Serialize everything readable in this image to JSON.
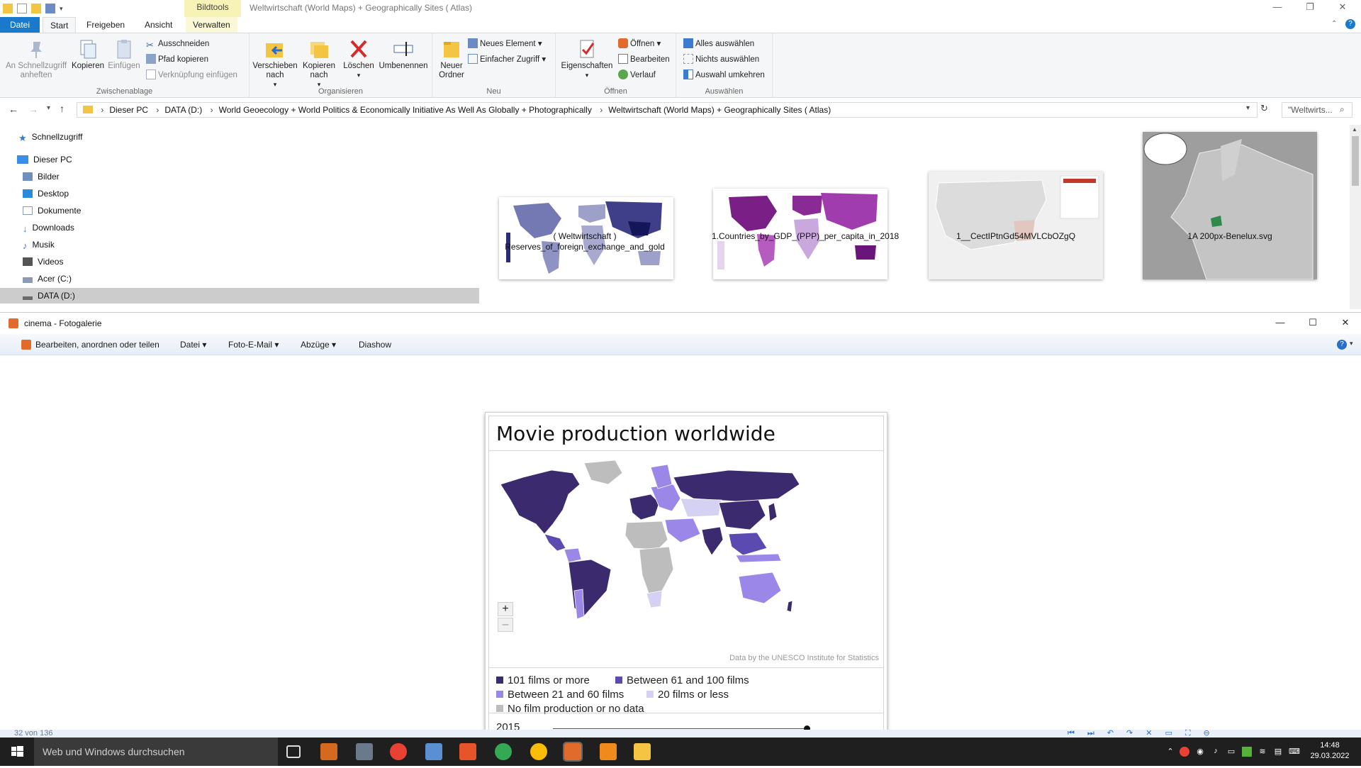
{
  "explorer": {
    "window_title": "Weltwirtschaft (World Maps) + Geographically Sites ( Atlas)",
    "context_tab": "Bildtools",
    "tabs": [
      "Datei",
      "Start",
      "Freigeben",
      "Ansicht",
      "Verwalten"
    ],
    "ribbon": {
      "clipboard": {
        "label": "Zwischenablage",
        "pin": "An Schnellzugriff anheften",
        "copy": "Kopieren",
        "paste": "Einfügen",
        "cut": "Ausschneiden",
        "copy_path": "Pfad kopieren",
        "paste_shortcut": "Verknüpfung einfügen"
      },
      "organize": {
        "label": "Organisieren",
        "move_to": "Verschieben nach",
        "copy_to": "Kopieren nach",
        "delete": "Löschen",
        "rename": "Umbenennen"
      },
      "new": {
        "label": "Neu",
        "new_folder": "Neuer Ordner",
        "new_item": "Neues Element",
        "easy_access": "Einfacher Zugriff"
      },
      "open": {
        "label": "Öffnen",
        "properties": "Eigenschaften",
        "open": "Öffnen",
        "edit": "Bearbeiten",
        "history": "Verlauf"
      },
      "select": {
        "label": "Auswählen",
        "select_all": "Alles auswählen",
        "select_none": "Nichts auswählen",
        "invert": "Auswahl umkehren"
      }
    },
    "address": [
      "Dieser PC",
      "DATA (D:)",
      "World Geoecology + World Politics & Economically Initiative As Well As Globally + Photographically",
      "Weltwirtschaft (World Maps) + Geographically Sites ( Atlas)"
    ],
    "search_placeholder": "\"Weltwirts...",
    "nav": {
      "quick_access": "Schnellzugriff",
      "this_pc": "Dieser PC",
      "items": [
        "Bilder",
        "Desktop",
        "Dokumente",
        "Downloads",
        "Musik",
        "Videos",
        "Acer (C:)",
        "DATA (D:)"
      ]
    },
    "files": [
      {
        "name_line1": "( Weltwirtschaft )",
        "name_line2": "Reserves_of_foreign_exchange_and_gold"
      },
      {
        "name_line1": "1.Countries_by_GDP_(PPP)_per_capita_in_2018",
        "name_line2": ""
      },
      {
        "name_line1": "1__CectIPtnGd54MVLCbOZgQ",
        "name_line2": ""
      },
      {
        "name_line1": "1A 200px-Benelux.svg",
        "name_line2": ""
      }
    ]
  },
  "gallery": {
    "window_title": "cinema - Fotogalerie",
    "menu": {
      "edit": "Bearbeiten, anordnen oder teilen",
      "file": "Datei",
      "email": "Foto-E-Mail",
      "prints": "Abzüge",
      "slideshow": "Diashow"
    },
    "photo": {
      "title": "Movie production worldwide",
      "credit": "Data by the UNESCO Institute for Statistics",
      "zoom_in": "+",
      "zoom_out": "–",
      "year": "2015",
      "year_slider_position": 1.0,
      "legend": [
        {
          "label": "101 films or more",
          "color": "#3b2a6d"
        },
        {
          "label": "Between 61 and 100 films",
          "color": "#5b4ab0"
        },
        {
          "label": "Between 21 and 60 films",
          "color": "#9b87e8"
        },
        {
          "label": "20 films or less",
          "color": "#d4d1f2"
        },
        {
          "label": "No film production or no data",
          "color": "#bdbdbd"
        }
      ]
    },
    "status": "32 von 136"
  },
  "taskbar": {
    "search": "Web und Windows durchsuchen",
    "time": "14:48",
    "date": "29.03.2022"
  }
}
